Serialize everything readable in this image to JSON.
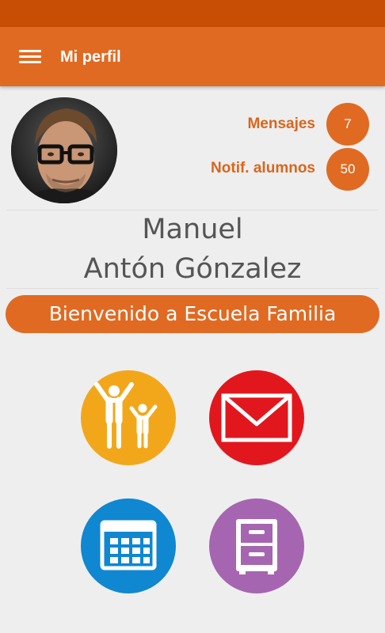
{
  "appbar": {
    "title": "Mi perfil",
    "menu_icon": "hamburger-menu-icon"
  },
  "profile": {
    "first_name": "Manuel",
    "last_name": "Antón Gónzalez",
    "avatar": "profile-photo"
  },
  "counters": {
    "messages_label": "Mensajes",
    "messages_count": "7",
    "notifications_label": "Notif. alumnos",
    "notifications_count": "50"
  },
  "welcome": {
    "text": "Bienvenido a Escuela Familia"
  },
  "tiles": [
    {
      "icon": "family-icon",
      "color": "#f2a71b"
    },
    {
      "icon": "mail-icon",
      "color": "#e2171d"
    },
    {
      "icon": "calendar-icon",
      "color": "#0f87d1"
    },
    {
      "icon": "cabinet-icon",
      "color": "#a565b0"
    }
  ],
  "colors": {
    "accent": "#e06a22",
    "statusbar": "#c84d05",
    "background": "#eeeeee"
  }
}
